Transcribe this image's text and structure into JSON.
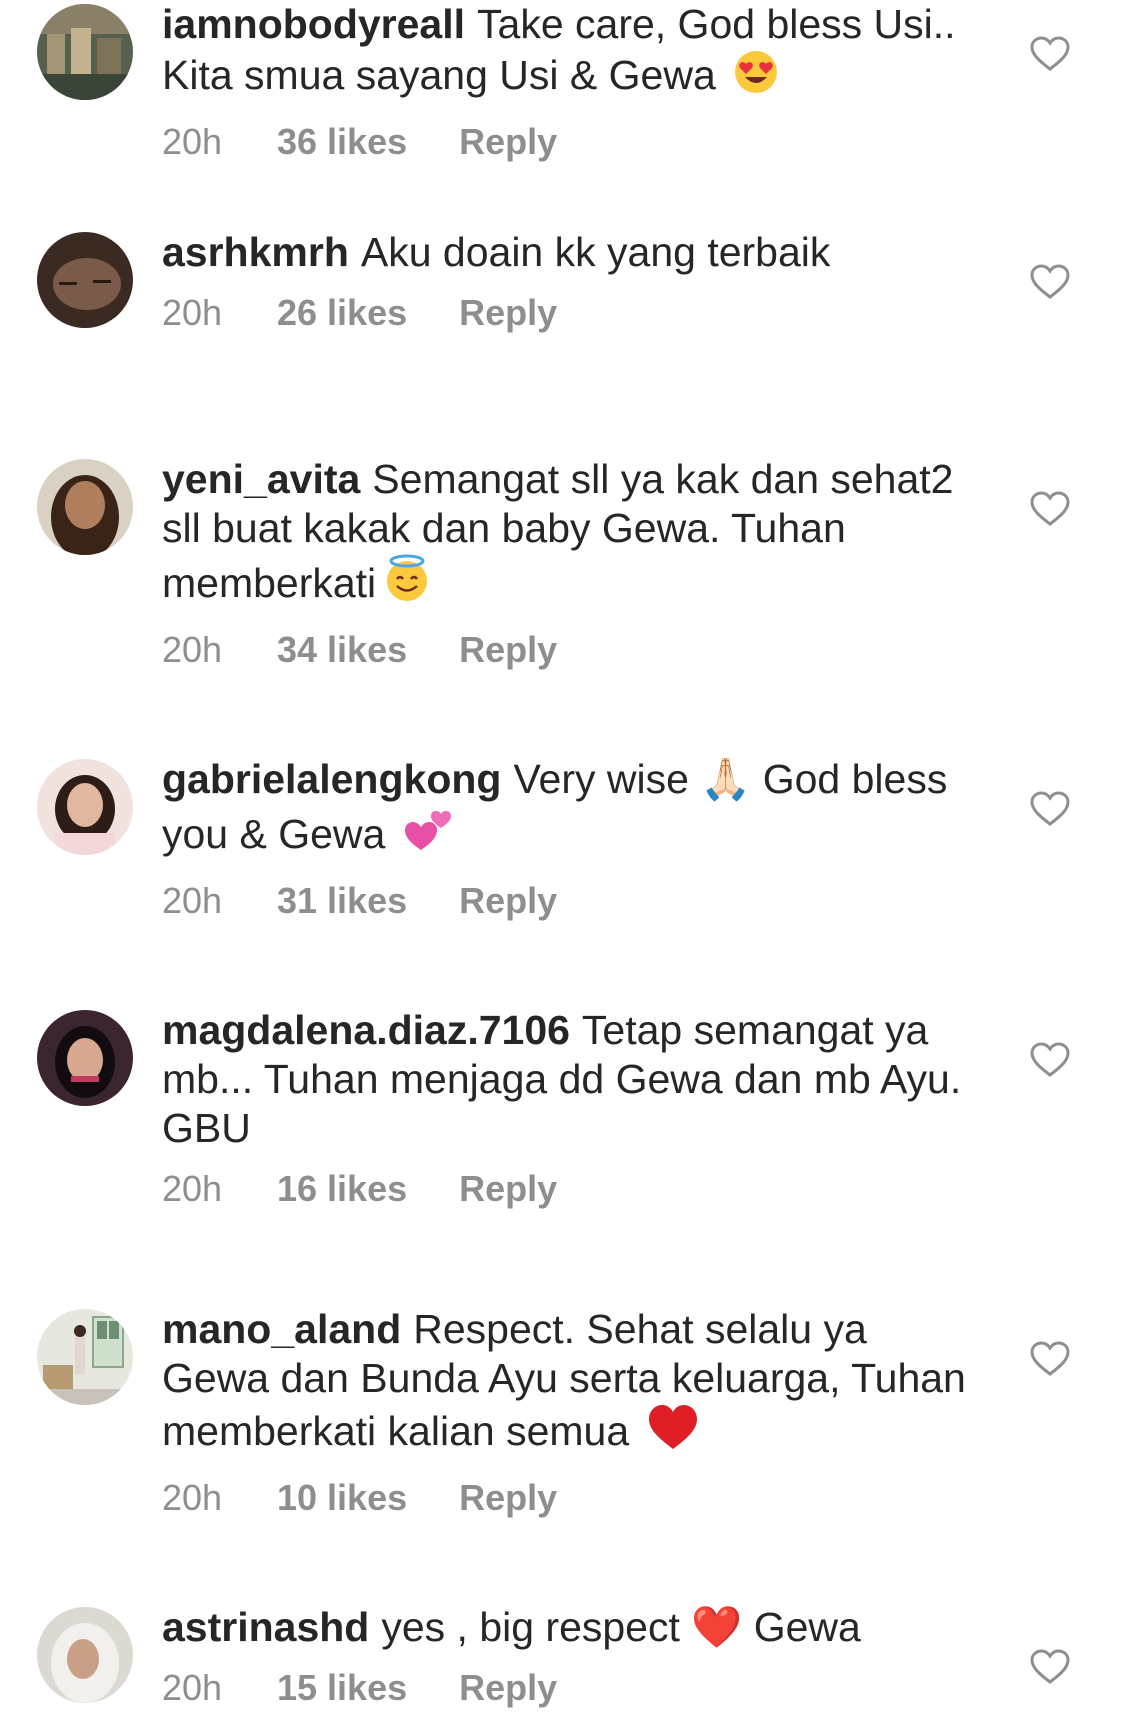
{
  "comments": [
    {
      "username": "iamnobodyreall",
      "text": "Take care, God bless Usi.. Kita smua sayang Usi & Gewa",
      "emoji": "smiling-face-heart-eyes",
      "time": "20h",
      "likes": "36 likes",
      "reply": "Reply",
      "avatar_color": "#4a5a4a"
    },
    {
      "username": "asrhkmrh",
      "text": "Aku doain kk yang terbaik",
      "time": "20h",
      "likes": "26 likes",
      "reply": "Reply",
      "avatar_color": "#4a3a30"
    },
    {
      "username": "yeni_avita",
      "text": "Semangat sll ya kak dan sehat2 sll buat kakak dan baby Gewa. Tuhan memberkati",
      "emoji": "smiling-face-halo",
      "time": "20h",
      "likes": "34 likes",
      "reply": "Reply",
      "avatar_color": "#6b4f3a"
    },
    {
      "username": "gabrielalengkong",
      "text": "Very wise 🙏🏻 God bless you & Gewa",
      "emoji": "two-hearts",
      "time": "20h",
      "likes": "31 likes",
      "reply": "Reply",
      "avatar_color": "#e8c8c0"
    },
    {
      "username": "magdalena.diaz.7106",
      "text": "Tetap semangat ya mb... Tuhan menjaga dd Gewa dan mb Ayu. GBU",
      "time": "20h",
      "likes": "16 likes",
      "reply": "Reply",
      "avatar_color": "#3a2a35"
    },
    {
      "username": "mano_aland",
      "text": "Respect. Sehat selalu ya Gewa dan Bunda Ayu serta keluarga, Tuhan memberkati kalian semua",
      "emoji": "red-heart",
      "time": "20h",
      "likes": "10 likes",
      "reply": "Reply",
      "avatar_color": "#b8c8b0"
    },
    {
      "username": "astrinashd",
      "text": "yes , big respect ❤️ Gewa",
      "time": "20h",
      "likes": "15 likes",
      "reply": "Reply",
      "avatar_color": "#cfcac4"
    }
  ],
  "colors": {
    "text": "#262626",
    "meta": "#8e8e8e",
    "heart_outline": "#8e8e8e"
  }
}
